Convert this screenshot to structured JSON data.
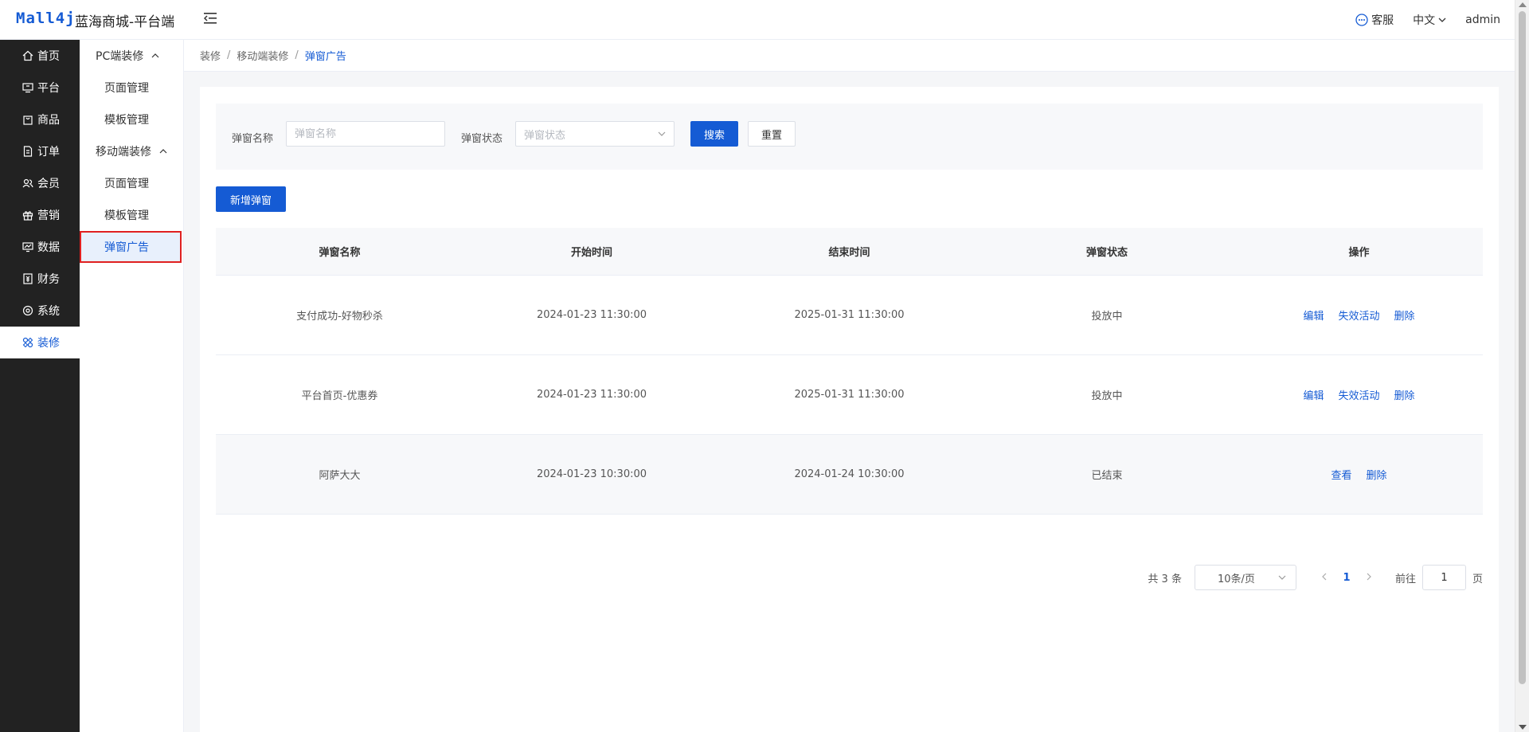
{
  "header": {
    "logo": "Mall4j",
    "brand": "蓝海商城-平台端",
    "service": "客服",
    "language": "中文",
    "user": "admin"
  },
  "menu": [
    {
      "label": "首页",
      "icon": "home-icon"
    },
    {
      "label": "平台",
      "icon": "monitor-icon"
    },
    {
      "label": "商品",
      "icon": "bag-icon"
    },
    {
      "label": "订单",
      "icon": "document-icon"
    },
    {
      "label": "会员",
      "icon": "users-icon"
    },
    {
      "label": "营销",
      "icon": "gift-icon"
    },
    {
      "label": "数据",
      "icon": "chart-icon"
    },
    {
      "label": "财务",
      "icon": "finance-icon"
    },
    {
      "label": "系统",
      "icon": "gear-icon"
    },
    {
      "label": "装修",
      "icon": "decorate-icon"
    }
  ],
  "submenu": {
    "pc_group": "PC端装修",
    "pc_items": [
      "页面管理",
      "模板管理"
    ],
    "mobile_group": "移动端装修",
    "mobile_items": [
      "页面管理",
      "模板管理",
      "弹窗广告"
    ]
  },
  "breadcrumb": [
    "装修",
    "移动端装修",
    "弹窗广告"
  ],
  "search": {
    "name_label": "弹窗名称",
    "name_placeholder": "弹窗名称",
    "status_label": "弹窗状态",
    "status_placeholder": "弹窗状态",
    "search_btn": "搜索",
    "reset_btn": "重置"
  },
  "add_button": "新增弹窗",
  "table": {
    "headers": [
      "弹窗名称",
      "开始时间",
      "结束时间",
      "弹窗状态",
      "操作"
    ],
    "rows": [
      {
        "name": "支付成功-好物秒杀",
        "start": "2024-01-23 11:30:00",
        "end": "2025-01-31 11:30:00",
        "status": "投放中",
        "actions": [
          "编辑",
          "失效活动",
          "删除"
        ]
      },
      {
        "name": "平台首页-优惠券",
        "start": "2024-01-23 11:30:00",
        "end": "2025-01-31 11:30:00",
        "status": "投放中",
        "actions": [
          "编辑",
          "失效活动",
          "删除"
        ]
      },
      {
        "name": "阿萨大大",
        "start": "2024-01-23 10:30:00",
        "end": "2024-01-24 10:30:00",
        "status": "已结束",
        "actions": [
          "查看",
          "删除"
        ]
      }
    ]
  },
  "pagination": {
    "total": "共 3 条",
    "page_size": "10条/页",
    "current": "1",
    "goto_label": "前往",
    "goto_value": "1",
    "page_suffix": "页"
  },
  "colors": {
    "accent": "#155bd4",
    "sidebar": "#222222",
    "highlight_border": "#e02020"
  }
}
